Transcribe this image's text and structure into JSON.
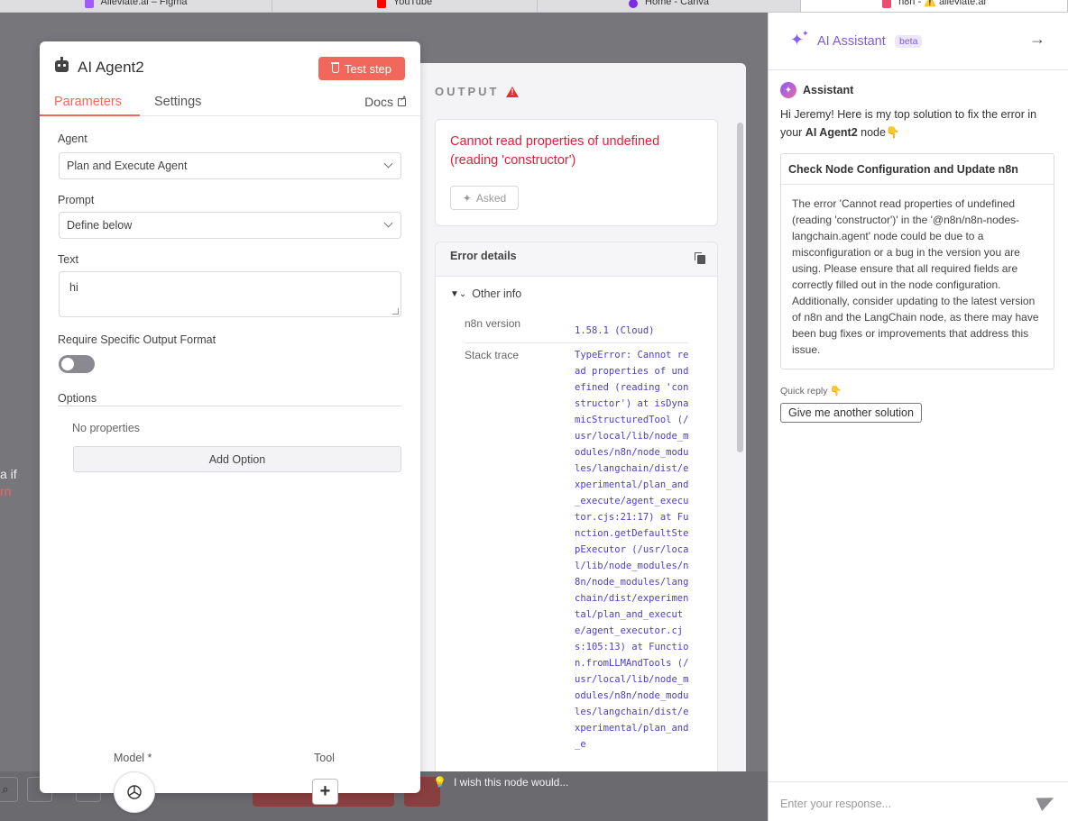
{
  "browser_tabs": [
    {
      "label": "Alleviate.ai – Figma",
      "icon": "figma-icon",
      "color": "#a259ff"
    },
    {
      "label": "YouTube",
      "icon": "youtube-icon",
      "color": "#ff0000"
    },
    {
      "label": "Home - Canva",
      "icon": "canva-icon",
      "color": "#7d2ae8"
    },
    {
      "label": "n8n - ⚠️ alleviate.ai",
      "icon": "n8n-icon",
      "color": "#ea4b71"
    }
  ],
  "canvas": {
    "fragment_text": "a if",
    "fragment_link": "rn",
    "feedback_text": "I wish this node would..."
  },
  "node": {
    "title": "AI Agent2",
    "test_step_label": "Test step",
    "tabs": [
      {
        "label": "Parameters",
        "active": true
      },
      {
        "label": "Settings",
        "active": false
      }
    ],
    "docs_label": "Docs",
    "agent_label": "Agent",
    "agent_value": "Plan and Execute Agent",
    "prompt_label": "Prompt",
    "prompt_value": "Define below",
    "text_label": "Text",
    "text_value": "hi",
    "require_format_label": "Require Specific Output Format",
    "require_format_enabled": false,
    "options_label": "Options",
    "no_properties": "No properties",
    "add_option_label": "Add Option",
    "model_label": "Model *",
    "tool_label": "Tool",
    "accent_color": "#f1675b"
  },
  "output": {
    "title": "OUTPUT",
    "error_message": "Cannot read properties of undefined (reading 'constructor')",
    "asked_label": "Asked",
    "details_title": "Error details",
    "other_info_label": "Other info",
    "n8n_version_label": "n8n version",
    "n8n_version_value": "1.58.1 (Cloud)",
    "stack_trace_label": "Stack trace",
    "stack_trace_value": "TypeError: Cannot read properties of undefined (reading 'constructor') at isDynamicStructuredTool (/usr/local/lib/node_modules/n8n/node_modules/langchain/dist/experimental/plan_and_execute/agent_executor.cjs:21:17) at Function.getDefaultStepExecutor (/usr/local/lib/node_modules/n8n/node_modules/langchain/dist/experimental/plan_and_execute/agent_executor.cjs:105:13) at Function.fromLLMAndTools (/usr/local/lib/node_modules/n8n/node_modules/langchain/dist/experimental/plan_and_e",
    "error_color": "#e0203a"
  },
  "assistant": {
    "title": "AI Assistant",
    "beta_label": "beta",
    "sender_name": "Assistant",
    "intro_prefix": "Hi Jeremy! Here is my top solution to fix the error in your ",
    "intro_node": "AI Agent2",
    "intro_suffix": " node👇",
    "solution_title": "Check Node Configuration and Update n8n",
    "solution_body": "The error 'Cannot read properties of undefined (reading 'constructor')' in the '@n8n/n8n-nodes-langchain.agent' node could be due to a misconfiguration or a bug in the version you are using. Please ensure that all required fields are correctly filled out in the node configuration. Additionally, consider updating to the latest version of n8n and the LangChain node, as there may have been bug fixes or improvements that address this issue.",
    "quick_reply_label": "Quick reply 👇",
    "quick_reply_button": "Give me another solution",
    "input_placeholder": "Enter your response...",
    "accent_color": "#7c5cd6"
  }
}
